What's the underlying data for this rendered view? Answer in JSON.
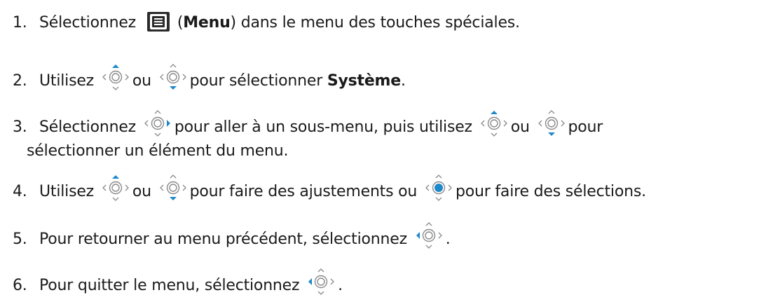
{
  "steps": [
    {
      "num": "1.",
      "pre": "Sélectionnez",
      "paren_open": "(",
      "bold": "Menu",
      "paren_close": ")",
      "post": " dans le menu des touches spéciales.",
      "icon": "menu-key-icon"
    },
    {
      "num": "2.",
      "pre": "Utilisez",
      "ou": "ou",
      "post": "pour sélectionner ",
      "bold": "Système",
      "end": ".",
      "icons": [
        "joystick-up-icon",
        "joystick-down-icon"
      ]
    },
    {
      "num": "3.",
      "pre": "Sélectionnez",
      "mid": "pour aller à un sous-menu, puis utilisez",
      "ou": "ou",
      "post": "pour",
      "cont": "sélectionner un élément du menu.",
      "icons": [
        "joystick-right-icon",
        "joystick-up-icon",
        "joystick-down-icon"
      ]
    },
    {
      "num": "4.",
      "pre": "Utilisez",
      "ou": "ou",
      "mid": "pour faire des ajustements ou",
      "post": "pour faire des sélections.",
      "icons": [
        "joystick-up-icon",
        "joystick-down-icon",
        "joystick-press-icon"
      ]
    },
    {
      "num": "5.",
      "pre": "Pour retourner au menu précédent, sélectionnez",
      "end": ".",
      "icons": [
        "joystick-left-icon"
      ]
    },
    {
      "num": "6.",
      "pre": "Pour quitter le menu, sélectionnez",
      "end": ".",
      "icons": [
        "joystick-left-icon"
      ]
    }
  ],
  "colors": {
    "text": "#1a1a1a",
    "icon_outline": "#8a8a8a",
    "active": "#1e88c9"
  }
}
